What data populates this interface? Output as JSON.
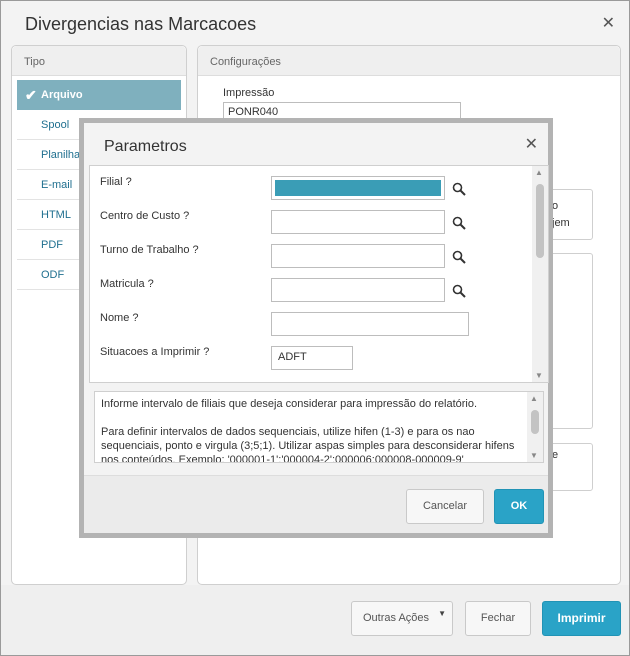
{
  "window": {
    "title": "Divergencias nas Marcacoes",
    "close_label": "✕"
  },
  "tipo_panel": {
    "title": "Tipo",
    "items": [
      {
        "label": "Arquivo",
        "selected": true
      },
      {
        "label": "Spool"
      },
      {
        "label": "Planilha"
      },
      {
        "label": "E-mail"
      },
      {
        "label": "HTML"
      },
      {
        "label": "PDF"
      },
      {
        "label": "ODF"
      }
    ]
  },
  "config_panel": {
    "title": "Configurações",
    "impressao_label": "Impressão",
    "impressao_value": "PONR040",
    "partial_texts": [
      "o",
      "jem",
      "e"
    ]
  },
  "footer": {
    "outras_acoes": "Outras Ações",
    "fechar": "Fechar",
    "imprimir": "Imprimir"
  },
  "dialog": {
    "title": "Parametros",
    "close_label": "✕",
    "fields": [
      {
        "label": "Filial ?",
        "value": "",
        "has_search": true,
        "filled": true
      },
      {
        "label": "Centro de Custo ?",
        "value": "",
        "has_search": true
      },
      {
        "label": "Turno de Trabalho ?",
        "value": "",
        "has_search": true
      },
      {
        "label": "Matricula ?",
        "value": "",
        "has_search": true
      },
      {
        "label": "Nome ?",
        "value": ""
      },
      {
        "label": "Situacoes a Imprimir ?",
        "value": "ADFT"
      }
    ],
    "help": {
      "line1": "Informe intervalo de filiais que deseja considerar para impressão do relatório.",
      "line2": "Para definir intervalos de dados sequenciais, utilize hifen (1-3) e para os nao sequenciais, ponto e virgula (3;5;1). Utilizar aspas simples para desconsiderar hifens nos conteúdos. Exemplo: '000001-1';'000004-2';000006;000008-000009-9'"
    },
    "cancel_label": "Cancelar",
    "ok_label": "OK"
  },
  "colors": {
    "accent": "#2aa3c7",
    "selected_item": "#7fb0be",
    "fill_bar": "#3a9db6"
  }
}
